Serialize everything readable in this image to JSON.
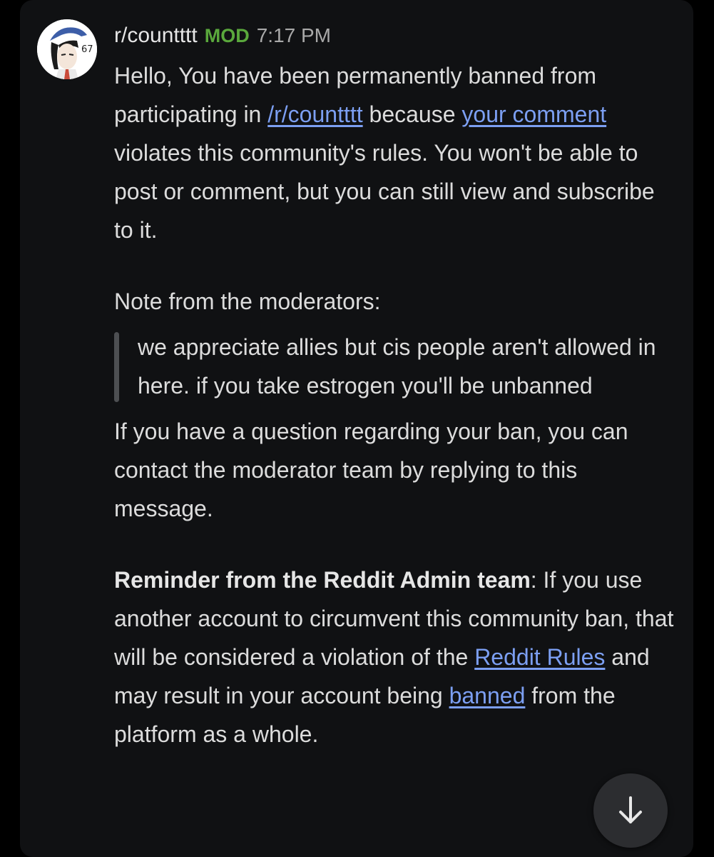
{
  "header": {
    "subreddit": "r/countttt",
    "badge": "MOD",
    "time": "7:17 PM"
  },
  "avatar": {
    "icon": "anime-character-avatar-icon",
    "text": "67"
  },
  "message": {
    "p1_a": "Hello, You have been permanently banned from participating in ",
    "p1_link1": "/r/countttt",
    "p1_b": " because ",
    "p1_link2": "your comment",
    "p1_c": " violates this community's rules. You won't be able to post or comment, but you can still view and subscribe to it.",
    "note_heading": "Note from the moderators:",
    "quote": "we appreciate allies but cis people aren't allowed in here. if you take estrogen you'll be unbanned",
    "p2": "If you have a question regarding your ban, you can contact the moderator team by replying to this message.",
    "reminder_bold": "Reminder from the Reddit Admin team",
    "reminder_a": ": If you use another account to circumvent this community ban, that will be considered a violation of the ",
    "reminder_link1": "Reddit Rules",
    "reminder_b": " and may result in your account being ",
    "reminder_link2": "banned",
    "reminder_c": " from the platform as a whole."
  },
  "scroll_button": {
    "icon": "arrow-down-icon"
  },
  "colors": {
    "background": "#000000",
    "card": "#101113",
    "text": "#dcdcdc",
    "link": "#7c9ff2",
    "mod_badge": "#5aa83c",
    "quote_bar": "#4d4f52"
  }
}
